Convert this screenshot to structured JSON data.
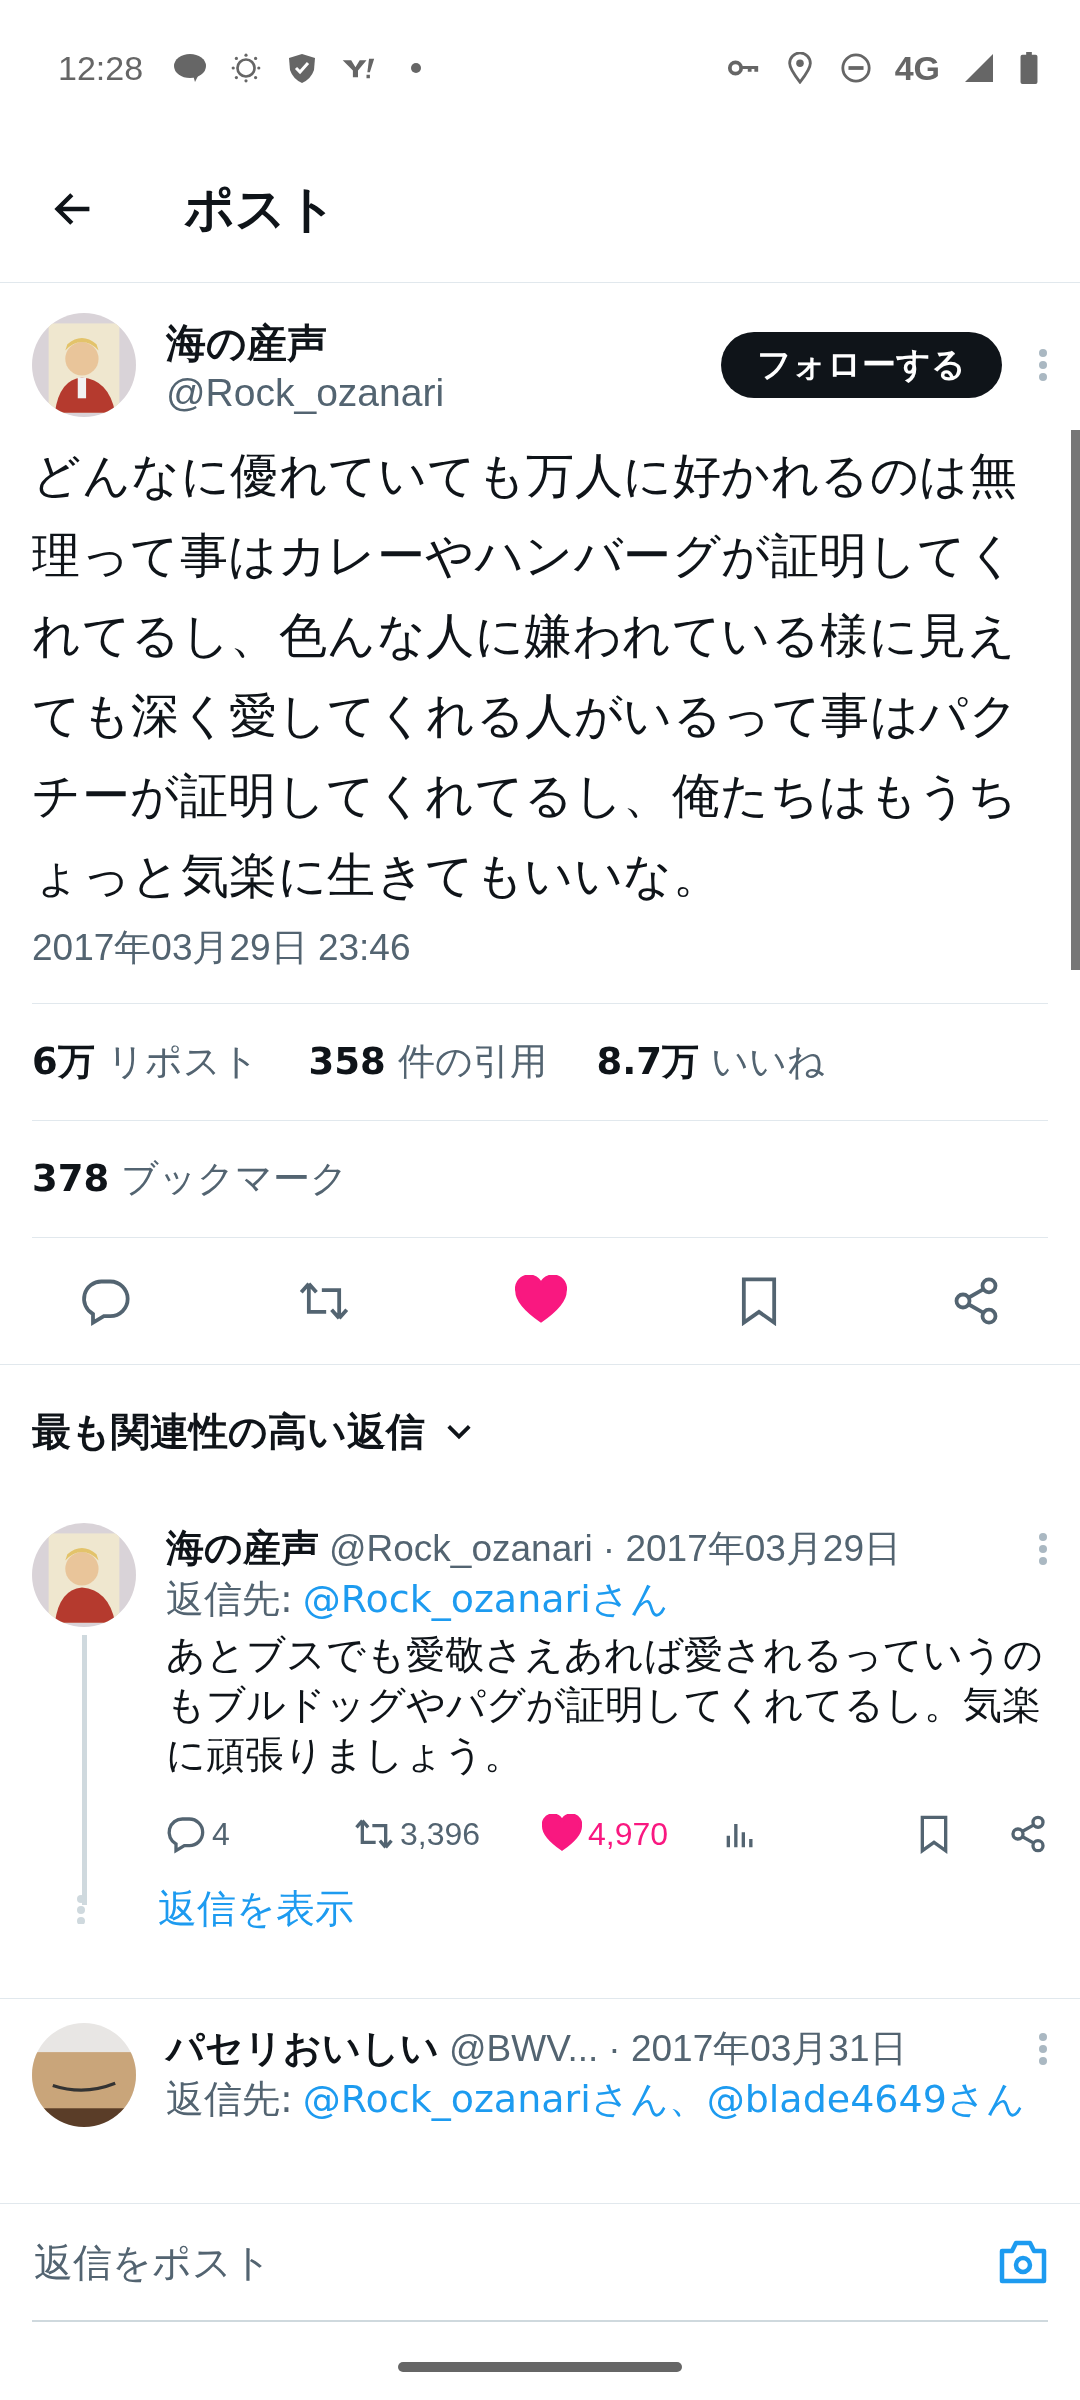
{
  "status_bar": {
    "time": "12:28",
    "network": "4G"
  },
  "header": {
    "title": "ポスト"
  },
  "post": {
    "author": {
      "name": "海の産声",
      "handle": "@Rock_ozanari"
    },
    "follow_button": "フォローする",
    "text": "どんなに優れていても万人に好かれるのは無理って事はカレーやハンバーグが証明してくれてるし、色んな人に嫌われている様に見えても深く愛してくれる人がいるって事はパクチーが証明してくれてるし、俺たちはもうちょっと気楽に生きてもいいな。",
    "timestamp": "2017年03月29日 23:46",
    "stats": [
      "**6万** リポスト",
      "**358** 件の引用",
      "**8.7万** いいね"
    ],
    "bookmarks": "**378** ブックマーク",
    "liked": true
  },
  "sort_label": "最も関連性の高い返信",
  "replies": [
    {
      "name": "海の産声",
      "handle": "@Rock_ozanari",
      "date": "· 2017年03月29日",
      "reply_to_label": "返信先:",
      "reply_to": "@Rock_ozanariさん",
      "text": "あとブスでも愛敬さえあれば愛されるっていうのもブルドッグやパグが証明してくれてるし。気楽に頑張りましょう。",
      "metrics": {
        "replies": "4",
        "reposts": "3,396",
        "likes": "4,970",
        "liked": true
      },
      "show_replies": "返信を表示"
    },
    {
      "name": "パセリおいしい",
      "handle": "@BWV...",
      "date": "· 2017年03月31日",
      "reply_to_label": "返信先:",
      "reply_to": "@Rock_ozanariさん、@blade4649さん"
    }
  ],
  "composer": {
    "placeholder": "返信をポスト"
  }
}
